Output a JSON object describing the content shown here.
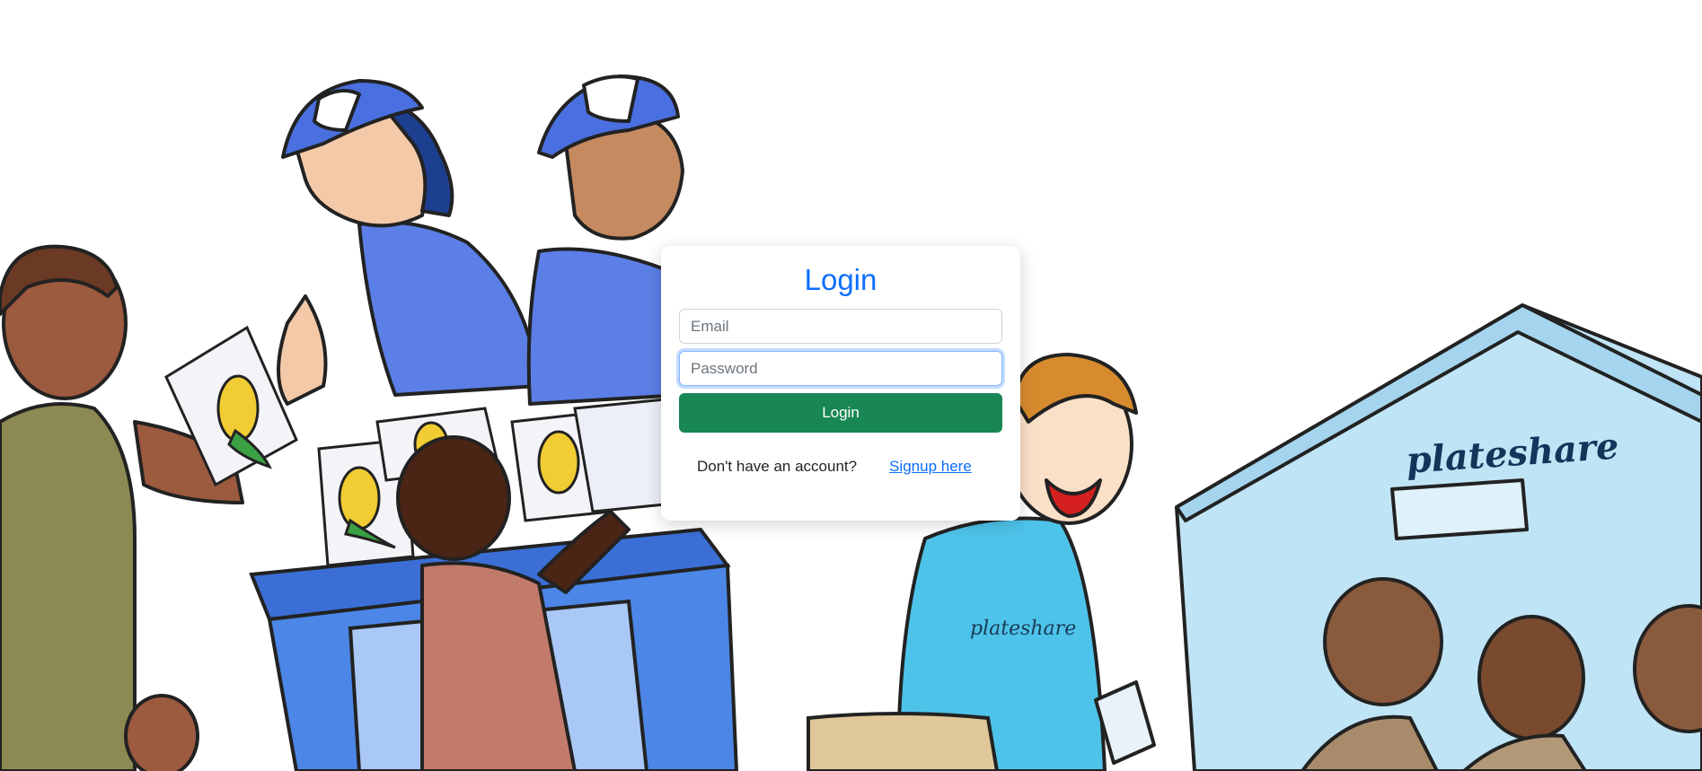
{
  "login": {
    "title": "Login",
    "email_placeholder": "Email",
    "password_placeholder": "Password",
    "button_label": "Login",
    "signup_prompt": "Don't have an account?",
    "signup_link": "Signup here"
  },
  "background": {
    "tent_brand_text": "plateshare",
    "shirt_brand_text": "plateshare",
    "colors": {
      "uniform_blue": "#5b7fe6",
      "tent_blue": "#bfe4f5",
      "volunteer_shirt": "#4ec3ea",
      "table_blue": "#3b6fd6",
      "corn_yellow": "#f1cc32",
      "leaf_green": "#3aa043"
    }
  }
}
